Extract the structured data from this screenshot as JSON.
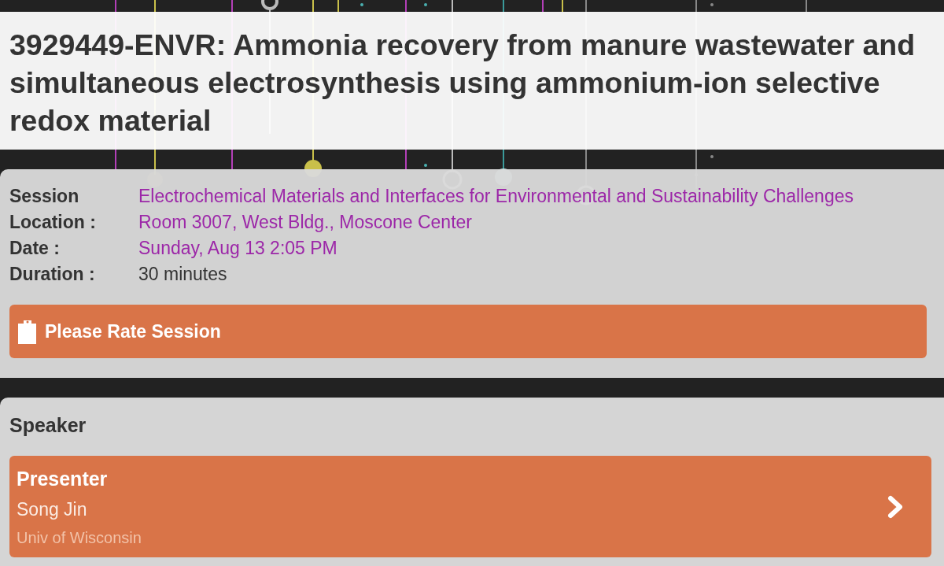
{
  "header": {
    "title": "3929449-ENVR: Ammonia recovery from manure wastewater and simultaneous electrosynthesis using ammonium-ion selective redox material"
  },
  "details": [
    {
      "label": "Session",
      "value": "Electrochemical Materials and Interfaces for Environmental and Sustainability Challenges",
      "kind": "link"
    },
    {
      "label": "Location :",
      "value": "Room 3007, West Bldg., Moscone Center",
      "kind": "link"
    },
    {
      "label": "Date :",
      "value": "Sunday, Aug 13 2:05 PM",
      "kind": "link"
    },
    {
      "label": "Duration :",
      "value": "30 minutes",
      "kind": "text"
    }
  ],
  "rate_button": {
    "label": "Please Rate Session"
  },
  "speaker_section": {
    "heading": "Speaker",
    "speakers": [
      {
        "role": "Presenter",
        "name": "Song Jin",
        "affiliation": "Univ of Wisconsin"
      }
    ]
  }
}
